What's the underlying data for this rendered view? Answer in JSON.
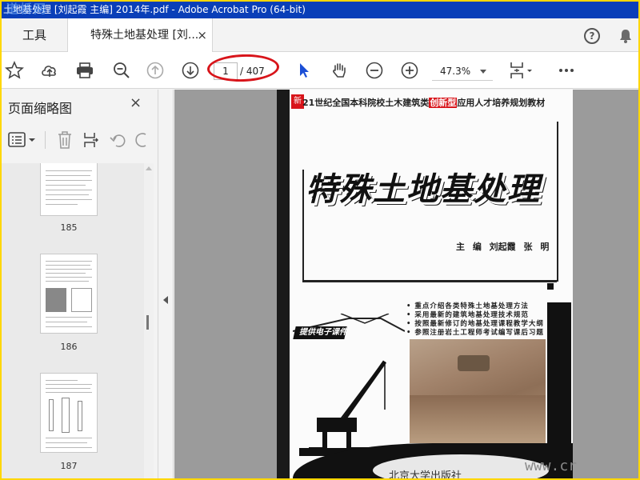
{
  "window": {
    "title": "土地基处理 [刘起霞 主编] 2014年.pdf - Adobe Acrobat Pro (64-bit)",
    "watermark": "道桥网"
  },
  "tabs": {
    "tools_label": "工具",
    "document_label": "特殊土地基处理 [刘...",
    "close_glyph": "×"
  },
  "toolbar": {
    "current_page": "1",
    "page_total": "/ 407",
    "zoom": "47.3%"
  },
  "thumbnail_panel": {
    "title": "页面缩略图",
    "close_glyph": "×",
    "thumbnails": [
      {
        "page": "185"
      },
      {
        "page": "186"
      },
      {
        "page": "187"
      }
    ]
  },
  "cover": {
    "badge": "新",
    "headline_pre": "21世纪全国本科院校土木建筑类",
    "headline_highlight": "创新型",
    "headline_post": "应用人才培养规划教材",
    "title": "特殊土地基处理",
    "authors": "主 编 刘起霞 张 明",
    "banner": "提供电子课件",
    "bullets": [
      "重点介绍各类特殊土地基处理方法",
      "采用最新的建筑地基处理技术规范",
      "按照最新修订的地基处理课程教学大纲",
      "参照注册岩土工程师考试编写课后习题"
    ],
    "publisher": "北京大学出版社"
  },
  "bottom_watermark": "www.cr"
}
